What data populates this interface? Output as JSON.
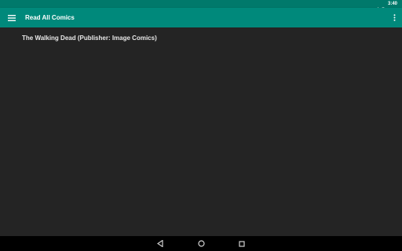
{
  "status_bar": {
    "time": "3:40",
    "icons": [
      "signal-icon",
      "battery-icon"
    ]
  },
  "app_bar": {
    "title": "Read All Comics",
    "menu_icon": "hamburger-menu-icon",
    "overflow_icon": "more-vert-icon"
  },
  "content": {
    "items": [
      {
        "label": "The Walking Dead (Publisher: Image Comics)"
      }
    ]
  },
  "nav_bar": {
    "buttons": [
      "back-icon",
      "home-icon",
      "recents-icon"
    ]
  },
  "colors": {
    "primary": "#00897b",
    "primary_dark": "#00796b",
    "background": "#242424",
    "nav_bar": "#000000"
  }
}
